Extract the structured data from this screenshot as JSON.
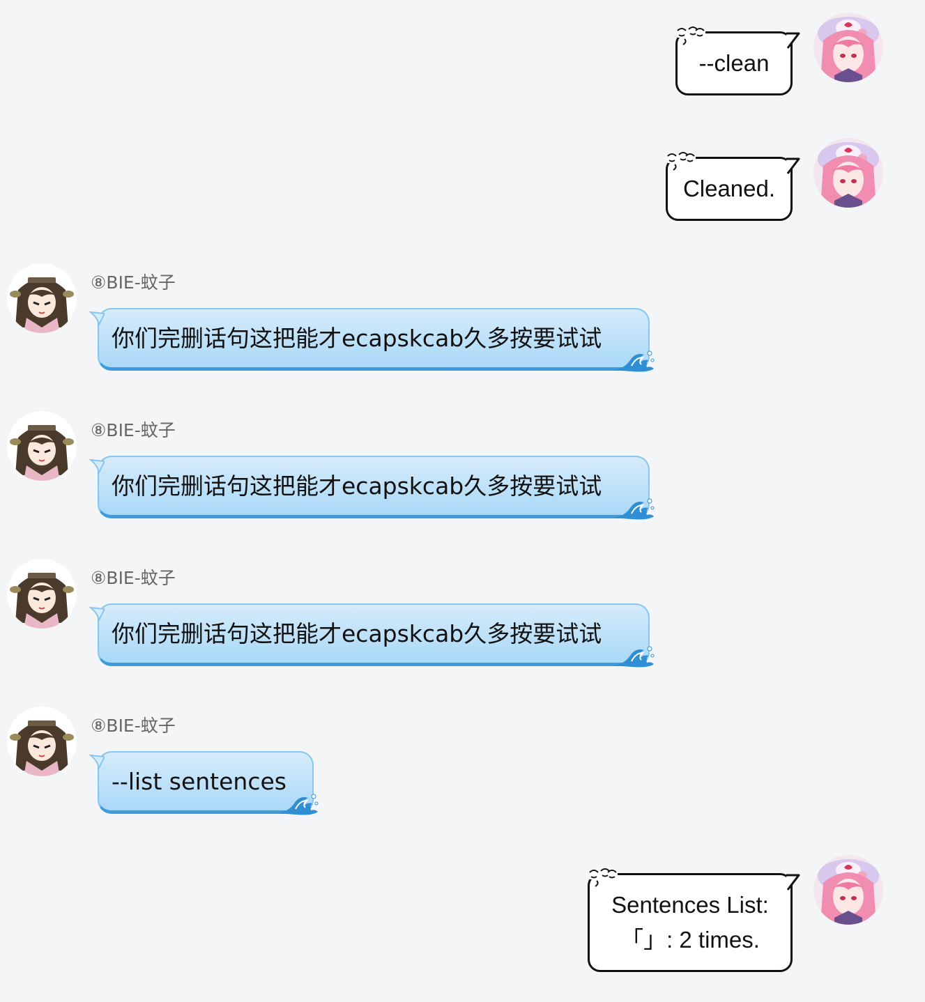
{
  "colors": {
    "background": "#f4f5f7",
    "incoming_bubble": "#b9e0fa",
    "incoming_bubble_border": "#3e9bdc",
    "outgoing_bubble": "#ffffff",
    "outgoing_border": "#111111"
  },
  "messages": [
    {
      "direction": "outgoing",
      "text": "--clean",
      "avatar": "pink-hair-avatar-icon"
    },
    {
      "direction": "outgoing",
      "text": "Cleaned.",
      "avatar": "pink-hair-avatar-icon"
    },
    {
      "direction": "incoming",
      "sender": "⑧BIE-蚊子",
      "text": "你们完删话句这把能才ecapskcab久多按要试试",
      "avatar": "brown-hair-avatar-icon"
    },
    {
      "direction": "incoming",
      "sender": "⑧BIE-蚊子",
      "text": "你们完删话句这把能才ecapskcab久多按要试试",
      "avatar": "brown-hair-avatar-icon"
    },
    {
      "direction": "incoming",
      "sender": "⑧BIE-蚊子",
      "text": "你们完删话句这把能才ecapskcab久多按要试试",
      "avatar": "brown-hair-avatar-icon"
    },
    {
      "direction": "incoming",
      "sender": "⑧BIE-蚊子",
      "text": "--list sentences",
      "avatar": "brown-hair-avatar-icon"
    },
    {
      "direction": "outgoing",
      "text_lines": [
        "Sentences List:",
        "「」: 2 times."
      ],
      "avatar": "pink-hair-avatar-icon"
    }
  ]
}
